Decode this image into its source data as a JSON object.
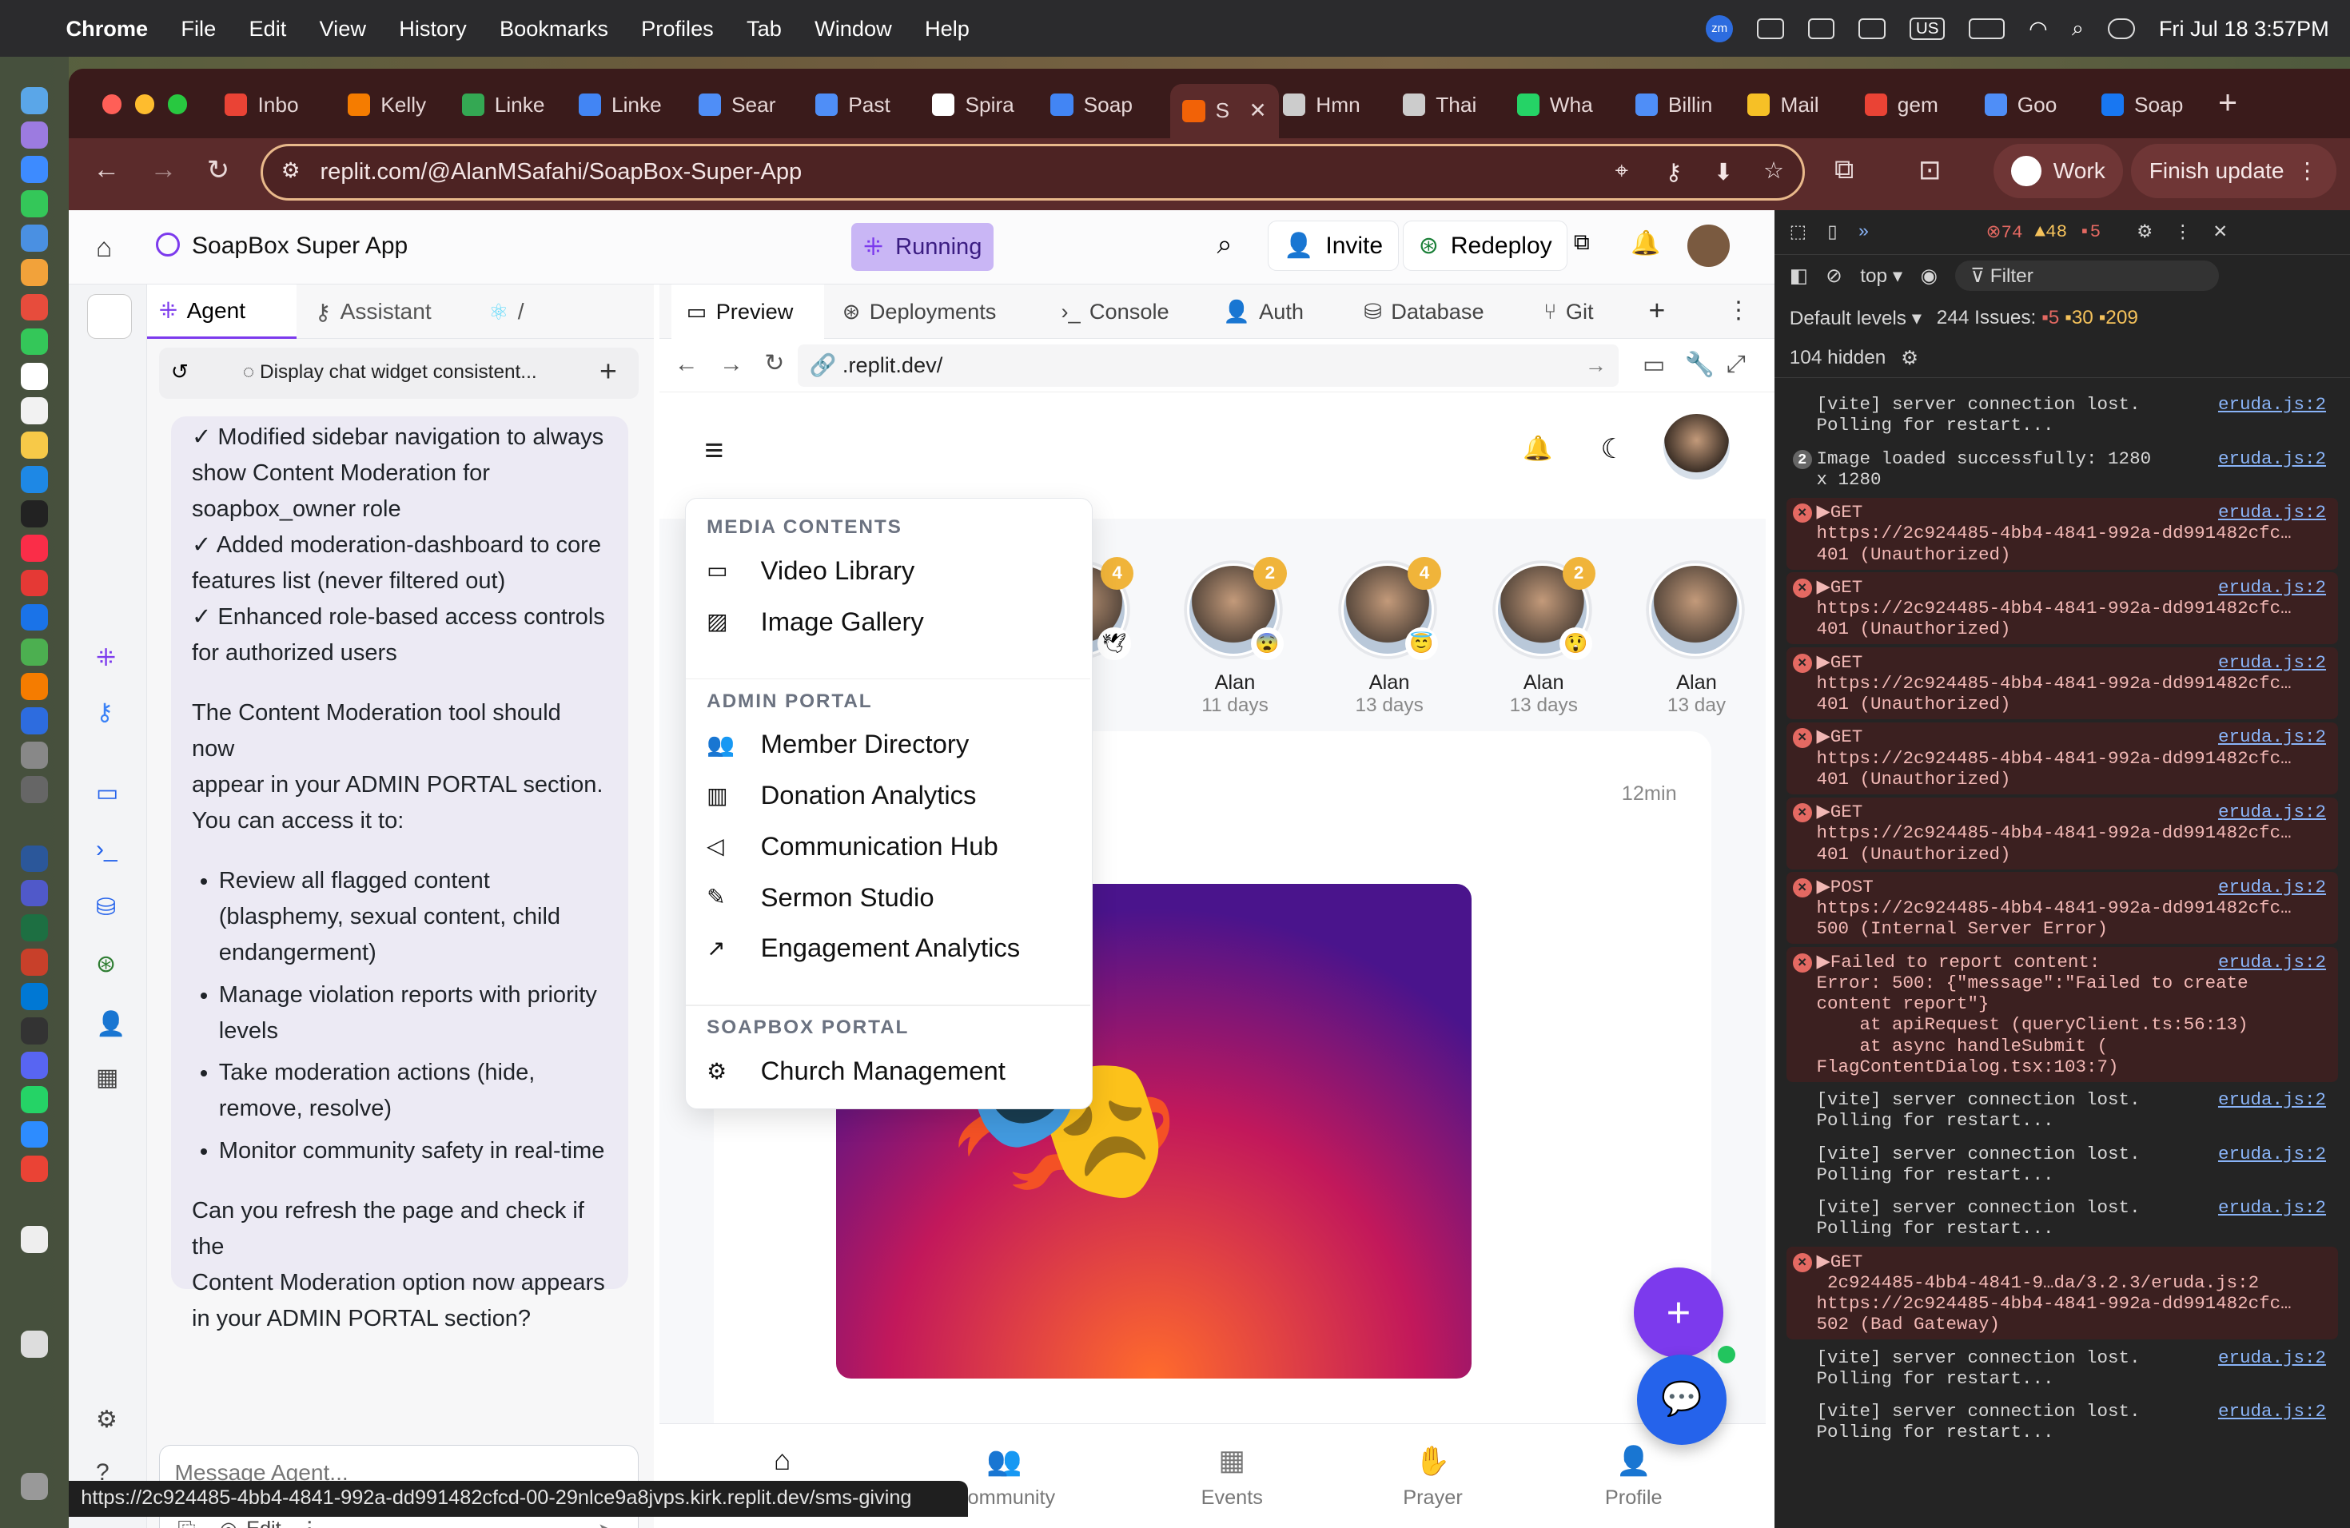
{
  "menubar": {
    "app": "Chrome",
    "items": [
      "File",
      "Edit",
      "View",
      "History",
      "Bookmarks",
      "Profiles",
      "Tab",
      "Window",
      "Help"
    ],
    "datetime": "Fri Jul 18  3:57PM"
  },
  "tabs": [
    {
      "label": "Inbo",
      "color": "#ea4335"
    },
    {
      "label": "Kelly",
      "color": "#f57c00"
    },
    {
      "label": "Linke",
      "color": "#34a853"
    },
    {
      "label": "Linke",
      "color": "#4285f4"
    },
    {
      "label": "Sear",
      "color": "#4f8ef7"
    },
    {
      "label": "Past",
      "color": "#4f8ef7"
    },
    {
      "label": "Spira",
      "color": "#ffffff"
    },
    {
      "label": "Soap",
      "color": "#4285f4"
    },
    {
      "label": "S",
      "color": "#f26207"
    },
    {
      "label": "Hmn",
      "color": "#cccccc"
    },
    {
      "label": "Thai",
      "color": "#cccccc"
    },
    {
      "label": "Wha",
      "color": "#25d366"
    },
    {
      "label": "Billin",
      "color": "#4f8ef7"
    },
    {
      "label": "Mail",
      "color": "#f6c026"
    },
    {
      "label": "gem",
      "color": "#ea4335"
    },
    {
      "label": "Goo",
      "color": "#4f8ef7"
    },
    {
      "label": "Soap",
      "color": "#1877f2"
    }
  ],
  "address": "replit.com/@AlanMSafahi/SoapBox-Super-App",
  "chrome_buttons": {
    "profile": "Work",
    "update": "Finish update"
  },
  "replit": {
    "project": "SoapBox Super App",
    "status": "Running",
    "invite": "Invite",
    "redeploy": "Redeploy",
    "agent_tabs": [
      "Agent",
      "Assistant",
      "/"
    ],
    "chat_title": "Display chat widget consistent...",
    "chat_lines_top": [
      "✓ Modified sidebar navigation to always",
      "show Content Moderation for",
      "soapbox_owner role",
      "✓ Added moderation-dashboard to core",
      "features list (never filtered out)",
      "✓ Enhanced role-based access controls",
      "for authorized users"
    ],
    "chat_para1": [
      "The Content Moderation tool should now",
      "appear in your ADMIN PORTAL section.",
      "You can access it to:"
    ],
    "chat_bullets": [
      [
        "Review all flagged content",
        "(blasphemy, sexual content, child",
        "endangerment)"
      ],
      [
        "Manage violation reports with priority",
        "levels"
      ],
      [
        "Take moderation actions (hide,",
        "remove, resolve)"
      ],
      [
        "Monitor community safety in real-time"
      ]
    ],
    "chat_para2": [
      "Can you refresh the page and check if the",
      "Content Moderation option now appears",
      "in your ADMIN PORTAL section?"
    ],
    "message_placeholder": "Message Agent...",
    "edit_label": "Edit",
    "preview_tabs": [
      "Preview",
      "Deployments",
      "Console",
      "Auth",
      "Database",
      "Git"
    ],
    "preview_url": ".replit.dev/"
  },
  "app": {
    "stories": [
      {
        "name": "n",
        "days": "ys",
        "badge": "4",
        "emoji": "🕊"
      },
      {
        "name": "Alan",
        "days": "11 days",
        "badge": "2",
        "emoji": "😨"
      },
      {
        "name": "Alan",
        "days": "13 days",
        "badge": "4",
        "emoji": "😇"
      },
      {
        "name": "Alan",
        "days": "13 days",
        "badge": "2",
        "emoji": "😲"
      },
      {
        "name": "Alan",
        "days": "13 day",
        "badge": "",
        "emoji": ""
      }
    ],
    "post_time": "12min",
    "menu": {
      "sections": [
        {
          "title": "MEDIA CONTENTS",
          "items": [
            "Video Library",
            "Image Gallery"
          ]
        },
        {
          "title": "ADMIN PORTAL",
          "items": [
            "Member Directory",
            "Donation Analytics",
            "Communication Hub",
            "Sermon Studio",
            "Engagement Analytics"
          ]
        },
        {
          "title": "SOAPBOX PORTAL",
          "items": [
            "Church Management"
          ]
        }
      ]
    },
    "nav": [
      "Home",
      "Community",
      "Events",
      "Prayer",
      "Profile"
    ]
  },
  "devtools": {
    "counts": {
      "errors": "74",
      "warnings": "48",
      "issues": "5"
    },
    "context": "top",
    "filter": "Filter",
    "levels": "Default levels",
    "issues_label": "244 Issues:",
    "issue_counts": [
      "5",
      "30",
      "209"
    ],
    "hidden": "104 hidden",
    "logs": [
      {
        "type": "info",
        "text": "[vite] server connection lost.\nPolling for restart...",
        "src": "eruda.js:2"
      },
      {
        "type": "info",
        "text": "Image loaded successfully: 1280\nx 1280",
        "src": "eruda.js:2",
        "count": "2"
      },
      {
        "type": "err",
        "text": "▶GET\nhttps://2c924485-4bb4-4841-992a-dd991482cfc…\n401 (Unauthorized)",
        "src": "eruda.js:2"
      },
      {
        "type": "err",
        "text": "▶GET\nhttps://2c924485-4bb4-4841-992a-dd991482cfc…\n401 (Unauthorized)",
        "src": "eruda.js:2"
      },
      {
        "type": "err",
        "text": "▶GET\nhttps://2c924485-4bb4-4841-992a-dd991482cfc…\n401 (Unauthorized)",
        "src": "eruda.js:2"
      },
      {
        "type": "err",
        "text": "▶GET\nhttps://2c924485-4bb4-4841-992a-dd991482cfc…\n401 (Unauthorized)",
        "src": "eruda.js:2"
      },
      {
        "type": "err",
        "text": "▶GET\nhttps://2c924485-4bb4-4841-992a-dd991482cfc…\n401 (Unauthorized)",
        "src": "eruda.js:2"
      },
      {
        "type": "err",
        "text": "▶POST\nhttps://2c924485-4bb4-4841-992a-dd991482cfc…\n500 (Internal Server Error)",
        "src": "eruda.js:2"
      },
      {
        "type": "err",
        "text": "▶Failed to report content:\nError: 500: {\"message\":\"Failed to create\ncontent report\"}\n    at apiRequest (queryClient.ts:56:13)\n    at async handleSubmit (\nFlagContentDialog.tsx:103:7)",
        "src": "eruda.js:2"
      },
      {
        "type": "info",
        "text": "[vite] server connection lost.\nPolling for restart...",
        "src": "eruda.js:2"
      },
      {
        "type": "info",
        "text": "[vite] server connection lost.\nPolling for restart...",
        "src": "eruda.js:2"
      },
      {
        "type": "info",
        "text": "[vite] server connection lost.\nPolling for restart...",
        "src": "eruda.js:2"
      },
      {
        "type": "err",
        "text": "▶GET\n 2c924485-4bb4-4841-9…da/3.2.3/eruda.js:2\nhttps://2c924485-4bb4-4841-992a-dd991482cfc…\n502 (Bad Gateway)",
        "src": ""
      },
      {
        "type": "info",
        "text": "[vite] server connection lost.\nPolling for restart...",
        "src": "eruda.js:2"
      },
      {
        "type": "info",
        "text": "[vite] server connection lost.\nPolling for restart...",
        "src": "eruda.js:2"
      }
    ]
  },
  "status_url": "https://2c924485-4bb4-4841-992a-dd991482cfcd-00-29nlce9a8jvps.kirk.replit.dev/sms-giving",
  "colors": {
    "accent": "#7c3aed",
    "running": "#c9b6f5",
    "url_border": "#e9b98b"
  }
}
